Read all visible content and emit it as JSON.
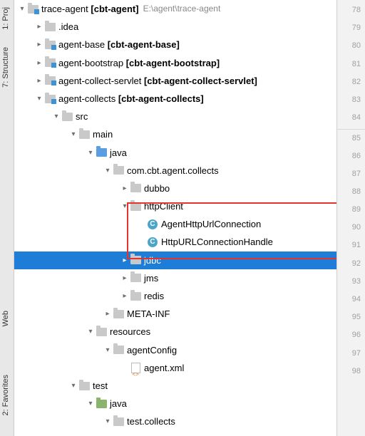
{
  "gutter": [
    "78",
    "79",
    "80",
    "81",
    "82",
    "83",
    "84",
    "85",
    "86",
    "87",
    "88",
    "89",
    "90",
    "91",
    "92",
    "93",
    "94",
    "95",
    "96",
    "97",
    "98"
  ],
  "sideTabs": {
    "proj": "1: Proj",
    "structure": "7: Structure",
    "web": "Web",
    "favorites": "2: Favorites"
  },
  "tree": {
    "root": {
      "name": "trace-agent",
      "qual": "[cbt-agent]",
      "path": "E:\\agent\\trace-agent"
    },
    "idea": ".idea",
    "agentBase": {
      "name": "agent-base",
      "qual": "[cbt-agent-base]"
    },
    "agentBootstrap": {
      "name": "agent-bootstrap",
      "qual": "[cbt-agent-bootstrap]"
    },
    "agentCollectServlet": {
      "name": "agent-collect-servlet",
      "qual": "[cbt-agent-collect-servlet]"
    },
    "agentCollects": {
      "name": "agent-collects",
      "qual": "[cbt-agent-collects]"
    },
    "src": "src",
    "main": "main",
    "java": "java",
    "pkg": "com.cbt.agent.collects",
    "dubbo": "dubbo",
    "httpClient": "httpClient",
    "classA": "AgentHttpUrlConnection",
    "classB": "HttpURLConnectionHandle",
    "jdbc": "jdbc",
    "jms": "jms",
    "redis": "redis",
    "metaInf": "META-INF",
    "resources": "resources",
    "agentConfig": "agentConfig",
    "agentXml": "agent.xml",
    "test": "test",
    "testJava": "java",
    "testPkg": "test.collects",
    "classC": "C"
  }
}
